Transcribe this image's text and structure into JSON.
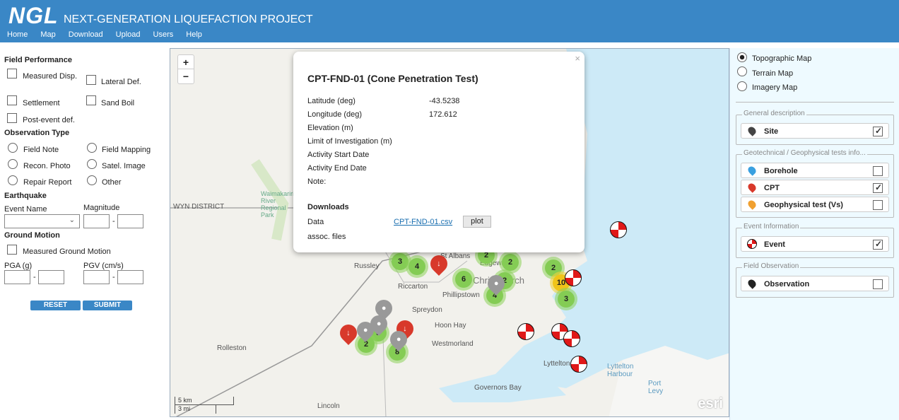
{
  "header": {
    "logo": "NGL",
    "title": "NEXT-GENERATION LIQUEFACTION PROJECT",
    "nav": [
      "Home",
      "Map",
      "Download",
      "Upload",
      "Users",
      "Help"
    ]
  },
  "filters": {
    "field_performance": {
      "title": "Field Performance",
      "options": [
        "Measured Disp.",
        "Lateral Def.",
        "Settlement",
        "Sand Boil",
        "Post-event def."
      ]
    },
    "observation_type": {
      "title": "Observation Type",
      "options": [
        "Field Note",
        "Field Mapping",
        "Recon. Photo",
        "Satel. Image",
        "Repair Report",
        "Other"
      ]
    },
    "earthquake": {
      "title": "Earthquake",
      "event_name_label": "Event Name",
      "event_name_value": "",
      "magnitude_label": "Magnitude",
      "magnitude_min": "",
      "magnitude_max": ""
    },
    "ground_motion": {
      "title": "Ground Motion",
      "measured_label": "Measured Ground Motion",
      "pga_label": "PGA (g)",
      "pgv_label": "PGV (cm/s)"
    },
    "reset": "RESET",
    "submit": "SUBMIT",
    "dash": "-"
  },
  "map": {
    "zoom_in": "+",
    "zoom_out": "−",
    "labels": [
      "WYN DISTRICT",
      "Waimakariri River Regional Park",
      "Russley",
      "Riccarton",
      "Phillipstown",
      "Spreydon",
      "Hoon Hay",
      "Westmorland",
      "Rolleston",
      "Lincoln",
      "Governors Bay",
      "Lyttelton",
      "Lyttelton Harbour",
      "Port Levy",
      "Christchurch",
      "Edgeware",
      "St Albans"
    ],
    "clusters": [
      "3",
      "4",
      "2",
      "2",
      "2",
      "6",
      "4",
      "2",
      "10",
      "3",
      "9",
      "2",
      "8"
    ],
    "scale": {
      "km": "5 km",
      "mi": "3 mi"
    },
    "attribution": "esri",
    "colors": {
      "cluster": "#84cc54",
      "cluster_large": "#f0c419",
      "cpt_pin": "#d8392b",
      "site_pin": "#999999",
      "event": "#e01818",
      "water": "#cdeaf7"
    }
  },
  "popup": {
    "title": "CPT-FND-01 (Cone Penetration Test)",
    "fields": [
      {
        "label": "Latitude (deg)",
        "value": "-43.5238"
      },
      {
        "label": "Longitude (deg)",
        "value": "172.612"
      },
      {
        "label": "Elevation (m)",
        "value": ""
      },
      {
        "label": "Limit of Investigation (m)",
        "value": ""
      },
      {
        "label": "Activity Start Date",
        "value": ""
      },
      {
        "label": "Activity End Date",
        "value": ""
      },
      {
        "label": "Note:",
        "value": ""
      }
    ],
    "downloads_title": "Downloads",
    "data_label": "Data",
    "data_link": "CPT-FND-01.csv",
    "plot": "plot",
    "assoc_label": "assoc. files",
    "close": "×"
  },
  "layers": {
    "basemaps": [
      {
        "label": "Topographic Map",
        "selected": true
      },
      {
        "label": "Terrain Map",
        "selected": false
      },
      {
        "label": "Imagery Map",
        "selected": false
      }
    ],
    "groups": [
      {
        "title": "General description",
        "items": [
          {
            "label": "Site",
            "checked": true,
            "color": "#444444"
          }
        ]
      },
      {
        "title": "Geotechnical / Geophysical tests info...",
        "items": [
          {
            "label": "Borehole",
            "checked": false,
            "color": "#3aa0e0"
          },
          {
            "label": "CPT",
            "checked": true,
            "color": "#d8392b"
          },
          {
            "label": "Geophysical test (Vs)",
            "checked": false,
            "color": "#f0a030"
          }
        ]
      },
      {
        "title": "Event Information",
        "items": [
          {
            "label": "Event",
            "checked": true,
            "color": "#e01818"
          }
        ]
      },
      {
        "title": "Field Observation",
        "items": [
          {
            "label": "Observation",
            "checked": false,
            "color": "#222222"
          }
        ]
      }
    ]
  }
}
